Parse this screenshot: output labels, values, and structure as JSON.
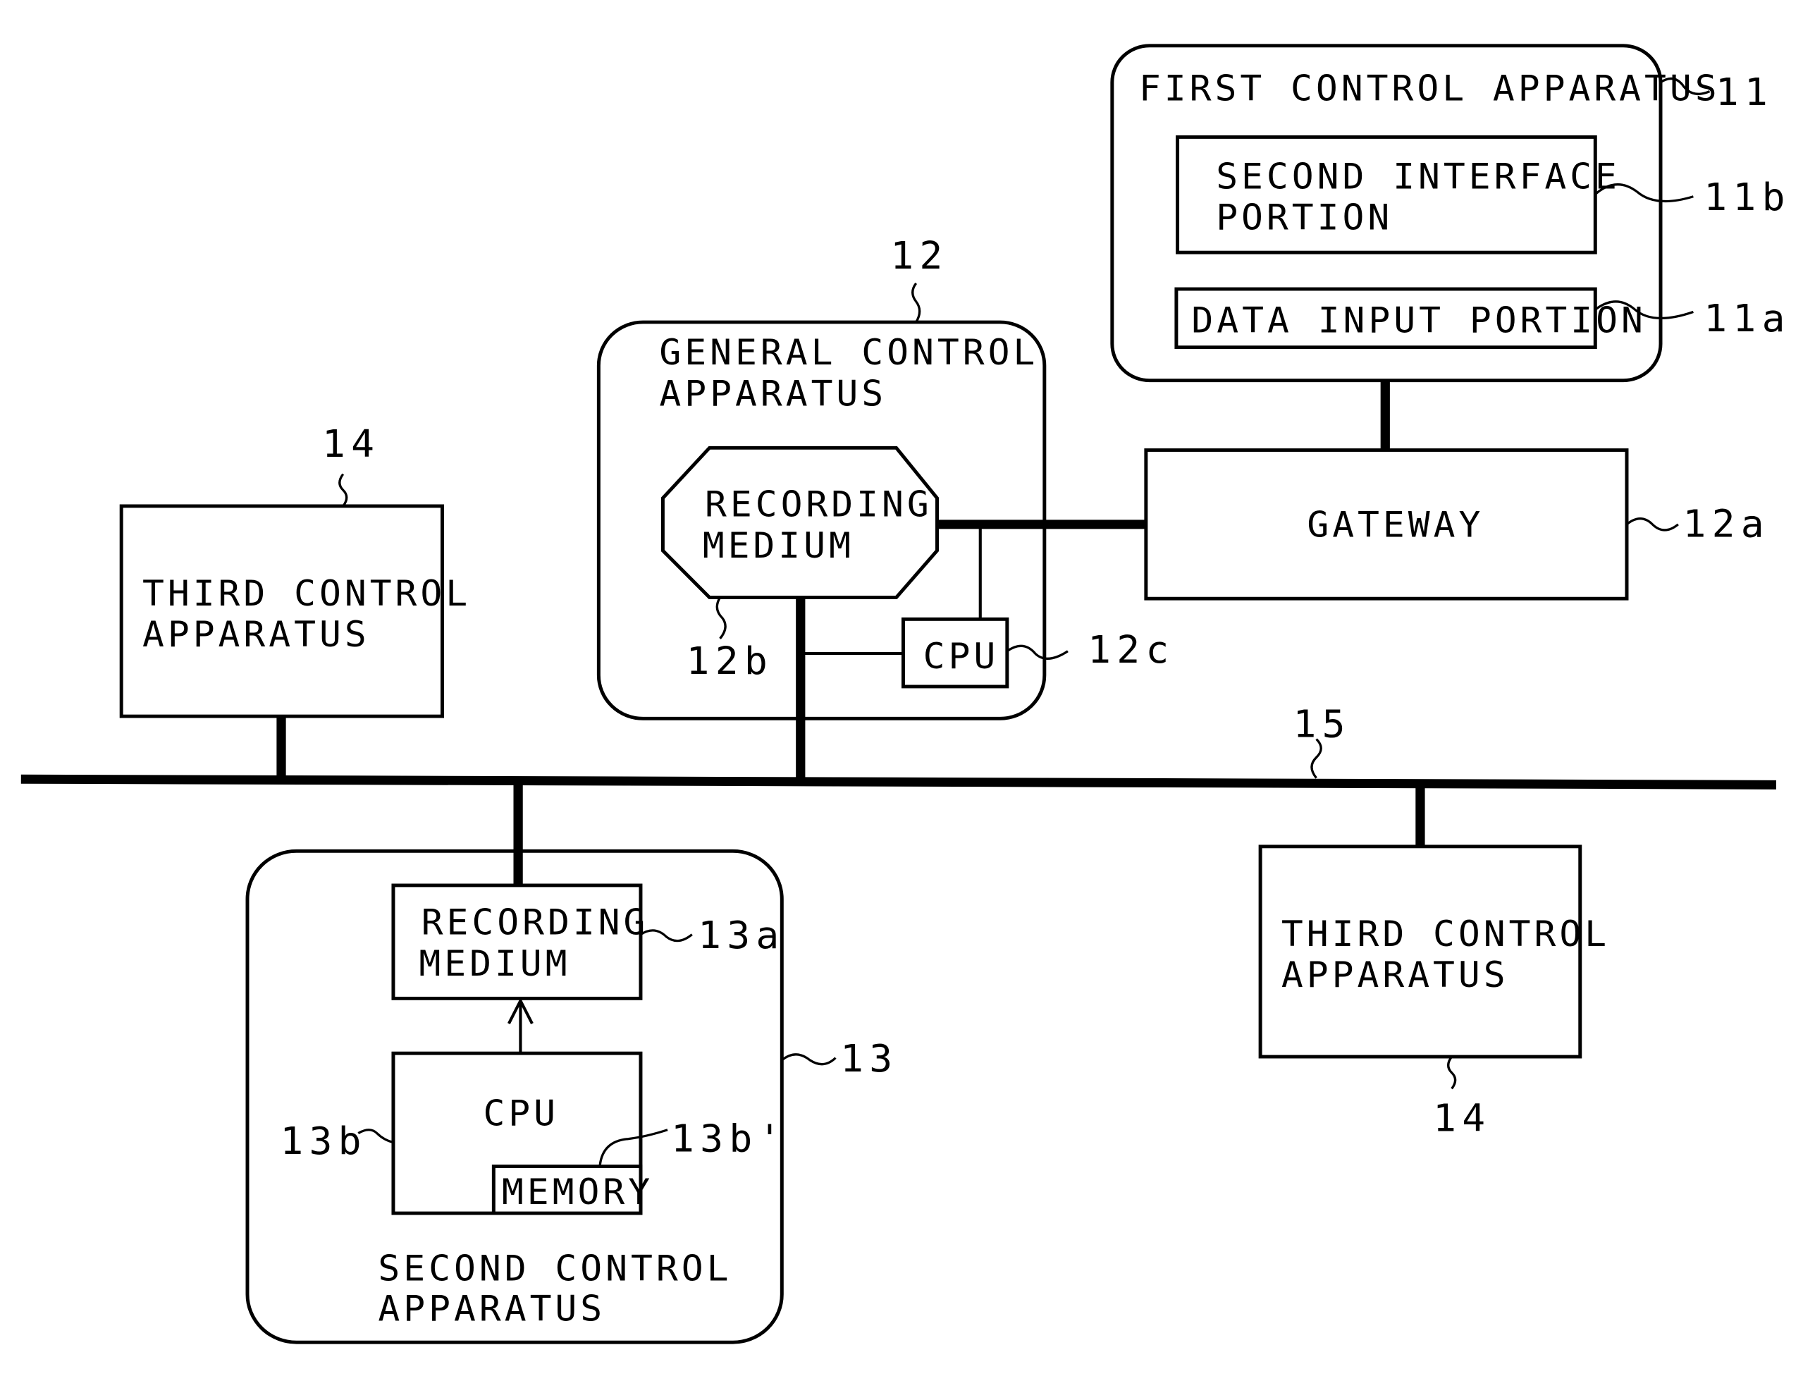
{
  "figure": {
    "type": "block-diagram",
    "colors": {
      "line": "#000000",
      "background": "#ffffff"
    }
  },
  "first_control": {
    "title": "FIRST CONTROL APPARATUS",
    "ref": "11",
    "second_interface": {
      "lines": [
        "SECOND INTERFACE",
        "PORTION"
      ],
      "ref": "11b"
    },
    "data_input": {
      "label": "DATA INPUT PORTION",
      "ref": "11a"
    }
  },
  "general_control": {
    "title_lines": [
      "GENERAL CONTROL",
      "APPARATUS"
    ],
    "ref": "12",
    "recording_medium": {
      "lines": [
        "RECORDING",
        "MEDIUM"
      ],
      "ref": "12b"
    },
    "cpu": {
      "label": "CPU",
      "ref": "12c"
    }
  },
  "gateway": {
    "label": "GATEWAY",
    "ref": "12a"
  },
  "second_control": {
    "title_lines": [
      "SECOND CONTROL",
      "APPARATUS"
    ],
    "ref": "13",
    "recording_medium": {
      "lines": [
        "RECORDING",
        "MEDIUM"
      ],
      "ref": "13a"
    },
    "cpu": {
      "label": "CPU",
      "ref": "13b"
    },
    "memory": {
      "label": "MEMORY",
      "ref": "13b'"
    }
  },
  "third_control_left": {
    "lines": [
      "THIRD CONTROL",
      "APPARATUS"
    ],
    "ref": "14"
  },
  "third_control_right": {
    "lines": [
      "THIRD CONTROL",
      "APPARATUS"
    ],
    "ref": "14"
  },
  "bus": {
    "ref": "15"
  }
}
